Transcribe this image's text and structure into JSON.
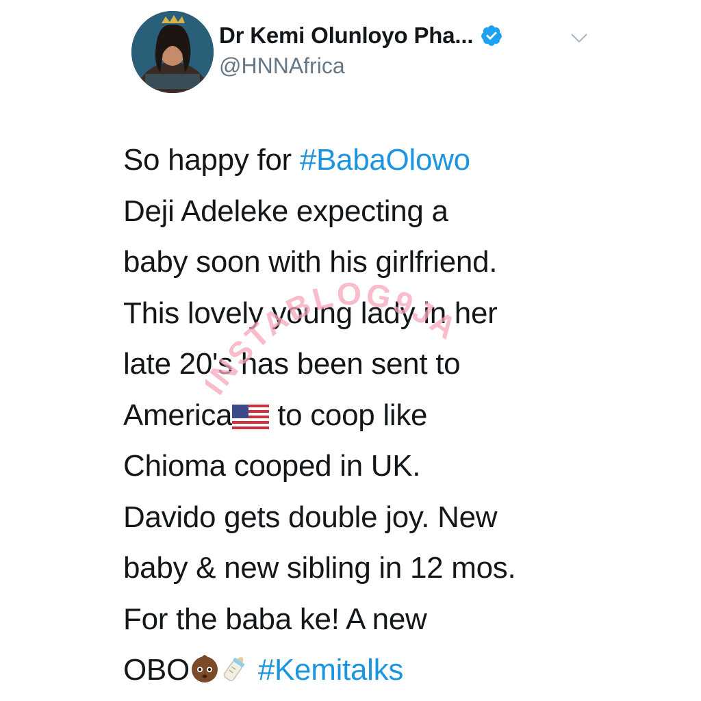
{
  "author": {
    "display_name": "Dr Kemi Olunloyo Pha...",
    "handle": "@HNNAfrica",
    "verified": true,
    "avatar_icon": "profile-photo"
  },
  "tweet": {
    "lines": [
      {
        "text": "So happy for ",
        "hashtag": "#BabaOlowo"
      },
      {
        "text": "Deji Adeleke expecting a"
      },
      {
        "text": "baby soon with his girlfriend."
      },
      {
        "text": "This lovely young lady in her"
      },
      {
        "text": "late 20's has been sent to"
      },
      {
        "text_before": "America",
        "emoji": "us-flag-emoji",
        "text_after": " to coop like"
      },
      {
        "text": "Chioma cooped in UK."
      },
      {
        "text": "Davido gets double joy. New"
      },
      {
        "text": "baby & new sibling in 12 mos."
      },
      {
        "text": "For the baba ke! A new"
      },
      {
        "text_before": "OBO",
        "emojis": [
          "baby-emoji",
          "baby-bottle-emoji"
        ],
        "hashtag": "#Kemitalks"
      }
    ]
  },
  "watermark": {
    "text": "INSTABLOG9JA"
  },
  "colors": {
    "hashtag": "#1b95e0",
    "text": "#14171a",
    "handle": "#657786",
    "verified": "#1da1f2",
    "watermark": "#f7a6b8"
  }
}
